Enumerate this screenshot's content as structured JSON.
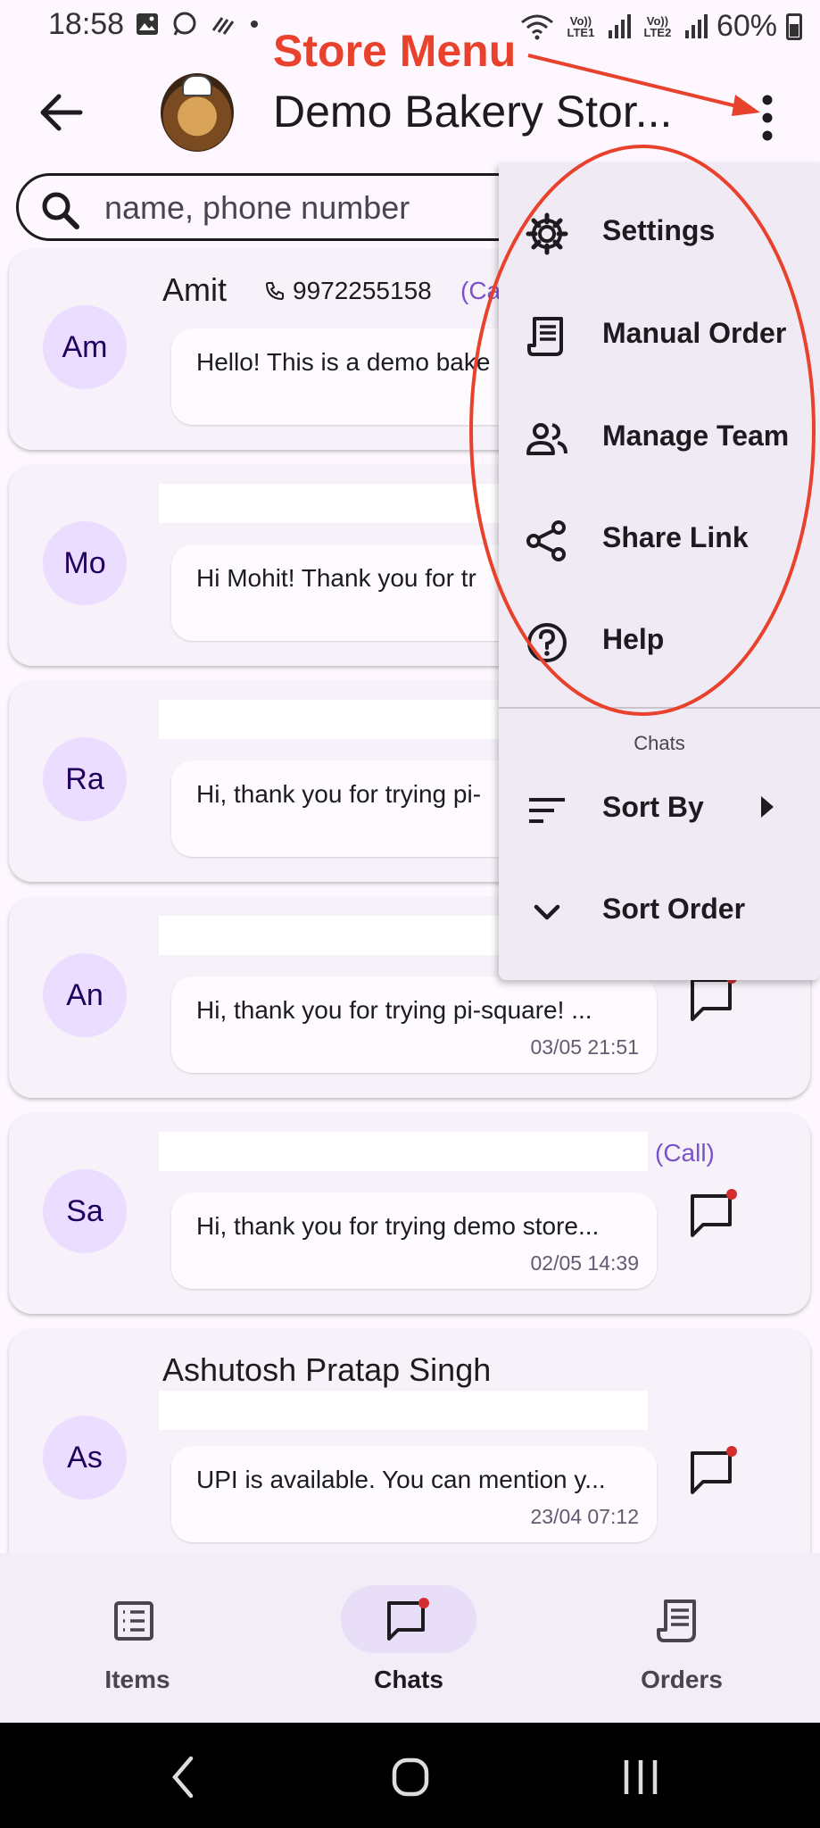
{
  "status_bar": {
    "time": "18:58",
    "net1": "Vo)) LTE1",
    "net2": "Vo)) LTE2",
    "battery": "60%"
  },
  "app_bar": {
    "store_title": "Demo Bakery Stor...",
    "annotation": "Store Menu"
  },
  "search": {
    "placeholder": "name, phone number"
  },
  "chats": [
    {
      "initials": "Am",
      "name": "Amit",
      "phone": "9972255158",
      "call": "(Ca",
      "message": "Hello! This is a demo bake",
      "time": ""
    },
    {
      "initials": "Mo",
      "name": "",
      "phone": "",
      "call": "",
      "message": "Hi Mohit! Thank you for tr",
      "time": ""
    },
    {
      "initials": "Ra",
      "name": "",
      "phone": "",
      "call": "",
      "message": "Hi, thank you for trying pi-",
      "time": ""
    },
    {
      "initials": "An",
      "name": "",
      "phone": "",
      "call": "",
      "message": "Hi, thank you for trying pi-square! ...",
      "time": "03/05 21:51"
    },
    {
      "initials": "Sa",
      "name": "",
      "phone": "",
      "call": "(Call)",
      "message": "Hi, thank you for trying demo store...",
      "time": "02/05 14:39"
    },
    {
      "initials": "As",
      "name": "Ashutosh Pratap Singh",
      "phone": "",
      "call": "",
      "message": "UPI is available. You can mention y...",
      "time": "23/04 07:12"
    }
  ],
  "menu": {
    "items": [
      {
        "label": "Settings",
        "icon": "gear-icon"
      },
      {
        "label": "Manual Order",
        "icon": "receipt-icon"
      },
      {
        "label": "Manage Team",
        "icon": "people-icon"
      },
      {
        "label": "Share Link",
        "icon": "share-icon"
      },
      {
        "label": "Help",
        "icon": "help-icon"
      }
    ],
    "section_title": "Chats",
    "sort_by": "Sort By",
    "sort_order": "Sort Order"
  },
  "bottom_nav": {
    "items": [
      "Items",
      "Chats",
      "Orders"
    ],
    "active": "Chats"
  },
  "colors": {
    "annotation": "#e8412c",
    "accent": "#7b52c8",
    "avatar_bg": "#eaddff",
    "badge": "#d32f2f"
  }
}
